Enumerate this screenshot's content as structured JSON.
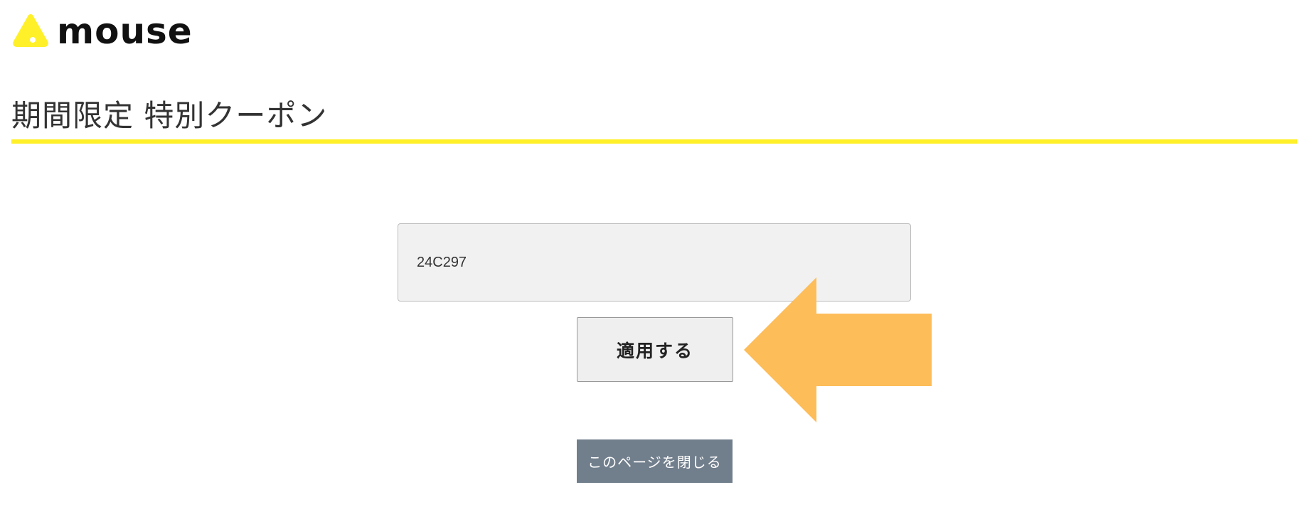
{
  "brand": {
    "name": "mouse",
    "logo_icon": "mouse-triangle-logo",
    "logo_color": "#fff029"
  },
  "page": {
    "title": "期間限定 特別クーポン",
    "accent_color": "#fff029"
  },
  "coupon": {
    "value": "24C297",
    "apply_label": "適用する"
  },
  "pointer": {
    "icon": "left-arrow-icon",
    "color": "#fdbd59"
  },
  "footer": {
    "close_label": "このページを閉じる",
    "close_color": "#717e8c"
  }
}
